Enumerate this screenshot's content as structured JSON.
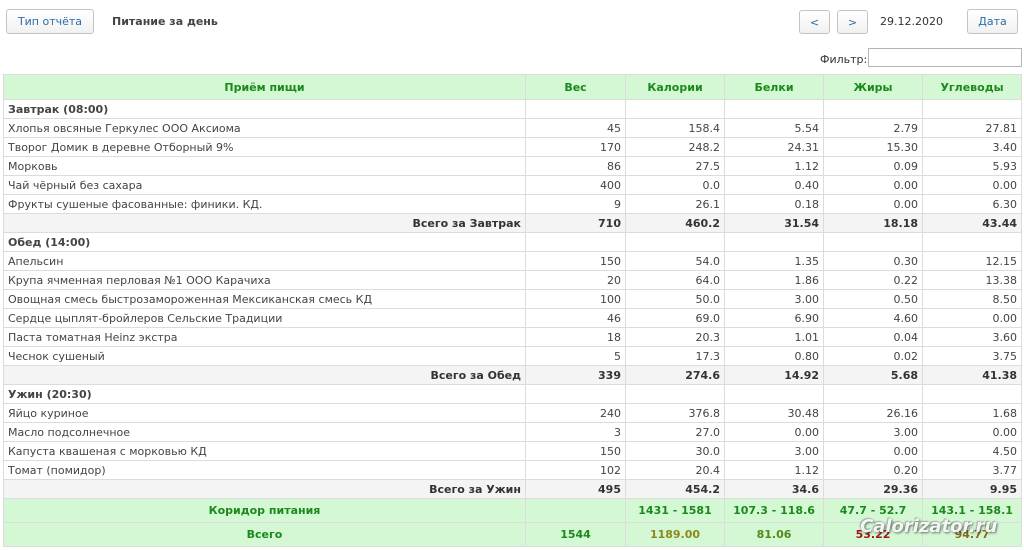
{
  "toolbar": {
    "report_type_label": "Тип отчёта",
    "title": "Питание за день",
    "prev_label": "<",
    "next_label": ">",
    "date": "29.12.2020",
    "date_button_label": "Дата",
    "filter_label": "Фильтр:",
    "filter_value": ""
  },
  "table": {
    "headers": [
      "Приём пищи",
      "Вес",
      "Калории",
      "Белки",
      "Жиры",
      "Углеводы"
    ],
    "meals": [
      {
        "name": "Завтрак (08:00)",
        "items": [
          [
            "Хлопья овсяные Геркулес ООО Аксиома",
            "45",
            "158.4",
            "5.54",
            "2.79",
            "27.81"
          ],
          [
            "Творог Домик в деревне Отборный 9%",
            "170",
            "248.2",
            "24.31",
            "15.30",
            "3.40"
          ],
          [
            "Морковь",
            "86",
            "27.5",
            "1.12",
            "0.09",
            "5.93"
          ],
          [
            "Чай чёрный без сахара",
            "400",
            "0.0",
            "0.40",
            "0.00",
            "0.00"
          ],
          [
            "Фрукты сушеные фасованные: финики. КД.",
            "9",
            "26.1",
            "0.18",
            "0.00",
            "6.30"
          ]
        ],
        "subtotal": [
          "Всего за Завтрак",
          "710",
          "460.2",
          "31.54",
          "18.18",
          "43.44"
        ]
      },
      {
        "name": "Обед (14:00)",
        "items": [
          [
            "Апельсин",
            "150",
            "54.0",
            "1.35",
            "0.30",
            "12.15"
          ],
          [
            "Крупа ячменная перловая №1 ООО Карачиха",
            "20",
            "64.0",
            "1.86",
            "0.22",
            "13.38"
          ],
          [
            "Овощная смесь быстрозамороженная Мексиканская смесь КД",
            "100",
            "50.0",
            "3.00",
            "0.50",
            "8.50"
          ],
          [
            "Сердце цыплят-бройлеров Сельские Традиции",
            "46",
            "69.0",
            "6.90",
            "4.60",
            "0.00"
          ],
          [
            "Паста томатная Heinz экстра",
            "18",
            "20.3",
            "1.01",
            "0.04",
            "3.60"
          ],
          [
            "Чеснок сушеный",
            "5",
            "17.3",
            "0.80",
            "0.02",
            "3.75"
          ]
        ],
        "subtotal": [
          "Всего за Обед",
          "339",
          "274.6",
          "14.92",
          "5.68",
          "41.38"
        ]
      },
      {
        "name": "Ужин (20:30)",
        "items": [
          [
            "Яйцо куриное",
            "240",
            "376.8",
            "30.48",
            "26.16",
            "1.68"
          ],
          [
            "Масло подсолнечное",
            "3",
            "27.0",
            "0.00",
            "3.00",
            "0.00"
          ],
          [
            "Капуста квашеная с морковью КД",
            "150",
            "30.0",
            "3.00",
            "0.00",
            "4.50"
          ],
          [
            "Томат (помидор)",
            "102",
            "20.4",
            "1.12",
            "0.20",
            "3.77"
          ]
        ],
        "subtotal": [
          "Всего за Ужин",
          "495",
          "454.2",
          "34.6",
          "29.36",
          "9.95"
        ]
      }
    ],
    "corridor": [
      "Коридор питания",
      "",
      "1431 - 1581",
      "107.3 - 118.6",
      "47.7 - 52.7",
      "143.1 - 158.1"
    ],
    "total": [
      "Всего",
      "1544",
      "1189.00",
      "81.06",
      "53.22",
      "94.77"
    ]
  },
  "watermark": "Calorizator.ru",
  "colors": {
    "header_bg": "#d4f7d4",
    "header_text": "#1a8a1a",
    "button_text": "#2a6ea8",
    "fat_total": "#a01818"
  }
}
